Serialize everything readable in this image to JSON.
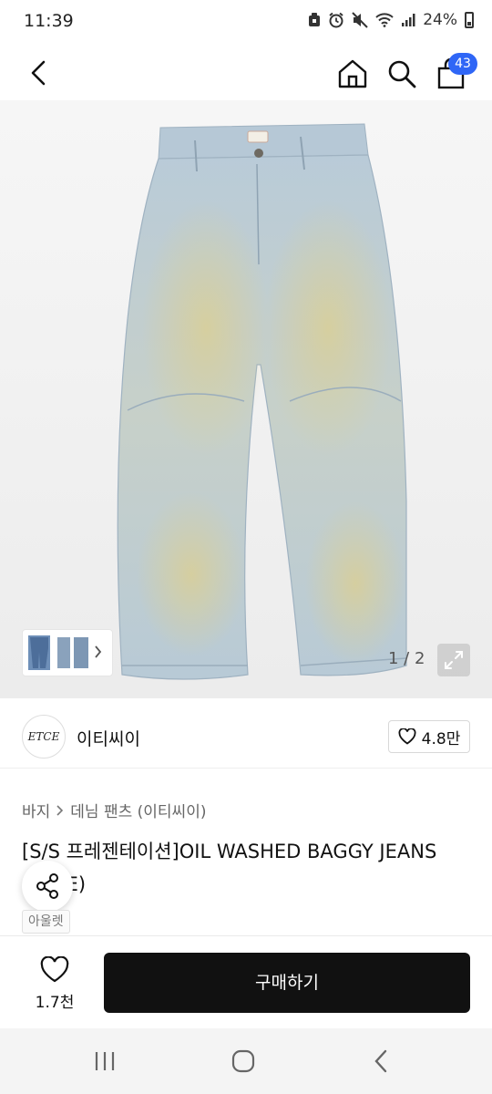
{
  "status_bar": {
    "time": "11:39",
    "battery": "24%"
  },
  "header": {
    "cart_count": "43",
    "accent_color": "#2f66f6"
  },
  "gallery": {
    "page_indicator": "1 / 2"
  },
  "brand": {
    "logo_text": "ETCE",
    "name": "이티씨이",
    "likes": "4.8만"
  },
  "breadcrumb": {
    "category": "바지",
    "subcategory": "데님 팬츠 (이티씨이)"
  },
  "product": {
    "title": "[S/S 프레젠테이션]OIL WASHED BAGGY JEANS (BLUE)",
    "tag": "아울렛"
  },
  "action_bar": {
    "wish_count": "1.7천",
    "buy_label": "구매하기"
  }
}
